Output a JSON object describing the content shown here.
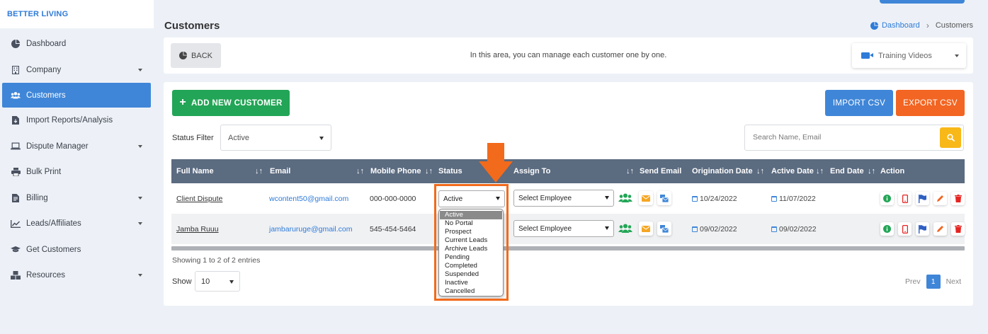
{
  "brand": "BETTER LIVING",
  "sidebar": {
    "items": [
      {
        "label": "Dashboard",
        "icon": "pie-chart-icon",
        "caret": false,
        "active": false
      },
      {
        "label": "Company",
        "icon": "building-icon",
        "caret": true,
        "active": false
      },
      {
        "label": "Customers",
        "icon": "users-icon",
        "caret": false,
        "active": true
      },
      {
        "label": "Import Reports/Analysis",
        "icon": "file-import-icon",
        "caret": false,
        "active": false
      },
      {
        "label": "Dispute Manager",
        "icon": "laptop-icon",
        "caret": true,
        "active": false
      },
      {
        "label": "Bulk Print",
        "icon": "printer-icon",
        "caret": false,
        "active": false
      },
      {
        "label": "Billing",
        "icon": "invoice-icon",
        "caret": true,
        "active": false
      },
      {
        "label": "Leads/Affiliates",
        "icon": "line-chart-icon",
        "caret": true,
        "active": false
      },
      {
        "label": "Get Customers",
        "icon": "graduation-cap-icon",
        "caret": false,
        "active": false
      },
      {
        "label": "Resources",
        "icon": "boxes-icon",
        "caret": true,
        "active": false
      }
    ]
  },
  "header": {
    "title": "Customers",
    "breadcrumb": {
      "home": "Dashboard",
      "current": "Customers"
    }
  },
  "info": {
    "back_label": "BACK",
    "text": "In this area, you can manage each customer one by one.",
    "training_label": "Training Videos"
  },
  "toolbar": {
    "add_label": "ADD NEW CUSTOMER",
    "import_label": "IMPORT CSV",
    "export_label": "EXPORT CSV",
    "status_filter_label": "Status Filter",
    "status_filter_value": "Active",
    "search_placeholder": "Search Name, Email"
  },
  "table": {
    "columns": [
      "Full Name",
      "Email",
      "Mobile Phone",
      "Status",
      "Assign To",
      "Send Email",
      "Origination Date",
      "Active Date",
      "End Date",
      "Action"
    ],
    "rows": [
      {
        "name": "Client Dispute",
        "email": "wcontent50@gmail.com",
        "phone": "000-000-0000",
        "status": "Active",
        "assign": "Select Employee",
        "origination": "10/24/2022",
        "active_date": "11/07/2022",
        "end_date": ""
      },
      {
        "name": "Jamba Ruuu",
        "email": "jambaruruge@gmail.com",
        "phone": "545-454-5464",
        "status": "",
        "assign": "Select Employee",
        "origination": "09/02/2022",
        "active_date": "09/02/2022",
        "end_date": ""
      }
    ]
  },
  "status_options": [
    "Active",
    "No Portal",
    "Prospect",
    "Current Leads",
    "Archive Leads",
    "Pending",
    "Completed",
    "Suspended",
    "Inactive",
    "Cancelled"
  ],
  "footer": {
    "entries": "Showing 1 to 2 of 2 entries",
    "show_label": "Show",
    "show_value": "10",
    "prev": "Prev",
    "page": "1",
    "next": "Next"
  },
  "colors": {
    "primary": "#3f86d8",
    "success": "#22a556",
    "orange": "#f26522",
    "header": "#5b6b80",
    "search": "#f8b818"
  }
}
